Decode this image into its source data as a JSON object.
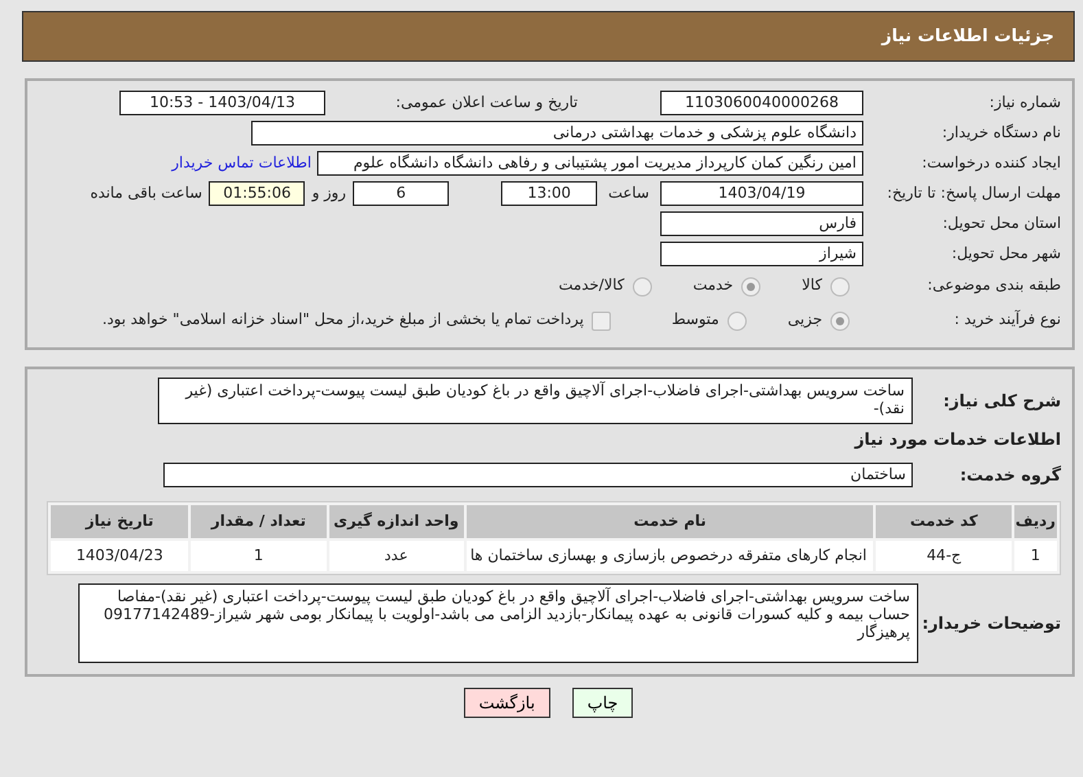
{
  "header": {
    "title": "جزئیات اطلاعات نیاز"
  },
  "need_number": {
    "label": "شماره نیاز:",
    "value": "1103060040000268"
  },
  "announce_datetime": {
    "label": "تاریخ و ساعت اعلان عمومی:",
    "value": "1403/04/13 - 10:53"
  },
  "buyer_org": {
    "label": "نام دستگاه خریدار:",
    "value": "دانشگاه علوم پزشکی و خدمات بهداشتی درمانی"
  },
  "requester": {
    "label": "ایجاد کننده درخواست:",
    "value": "امین رنگین کمان کارپرداز مدیریت امور پشتیبانی و رفاهی دانشگاه دانشگاه علوم",
    "contact_link": "اطلاعات تماس خریدار"
  },
  "deadline": {
    "label": "مهلت ارسال پاسخ: تا تاریخ:",
    "date": "1403/04/19",
    "time_label": "ساعت",
    "time": "13:00",
    "days": "6",
    "days_label": "روز و",
    "remaining": "01:55:06",
    "remaining_label": "ساعت باقی مانده"
  },
  "province": {
    "label": "استان محل تحویل:",
    "value": "فارس"
  },
  "city": {
    "label": "شهر محل تحویل:",
    "value": "شیراز"
  },
  "category": {
    "label": "طبقه بندی موضوعی:",
    "options": [
      {
        "label": "کالا",
        "selected": false
      },
      {
        "label": "خدمت",
        "selected": true
      },
      {
        "label": "کالا/خدمت",
        "selected": false
      }
    ]
  },
  "purchase_process": {
    "label": "نوع فرآیند خرید :",
    "options": [
      {
        "label": "جزیی",
        "selected": true
      },
      {
        "label": "متوسط",
        "selected": false
      }
    ],
    "payment_checkbox": {
      "label": "پرداخت تمام یا بخشی از مبلغ خرید،از محل \"اسناد خزانه اسلامی\" خواهد بود.",
      "checked": false
    }
  },
  "description": {
    "label": "شرح کلی نیاز:",
    "value": "ساخت سرویس بهداشتی-اجرای فاضلاب-اجرای آلاچیق واقع در باغ کودیان طبق لیست پیوست-پرداخت اعتباری (غیر نقد)-"
  },
  "services_section": {
    "title": "اطلاعات خدمات مورد نیاز"
  },
  "service_group": {
    "label": "گروه خدمت:",
    "value": "ساختمان"
  },
  "table": {
    "columns": [
      "ردیف",
      "کد خدمت",
      "نام خدمت",
      "واحد اندازه گیری",
      "تعداد / مقدار",
      "تاریخ نیاز"
    ],
    "rows": [
      [
        "1",
        "ج-44",
        "انجام کارهای متفرقه درخصوص بازسازی و بهسازی ساختمان ها",
        "عدد",
        "1",
        "1403/04/23"
      ]
    ]
  },
  "buyer_notes": {
    "label": "توضیحات خریدار:",
    "value": "ساخت سرویس بهداشتی-اجرای فاضلاب-اجرای آلاچیق واقع در باغ کودیان طبق لیست پیوست-پرداخت اعتباری (غیر نقد)-مفاصا حساب بیمه و کلیه کسورات قانونی  به عهده پیمانکار-بازدید الزامی می باشد-اولویت با پیمانکار بومی شهر شیراز-09177142489 پرهیزگار"
  },
  "buttons": [
    {
      "label": "چاپ",
      "kind": "print"
    },
    {
      "label": "بازگشت",
      "kind": "back"
    }
  ]
}
